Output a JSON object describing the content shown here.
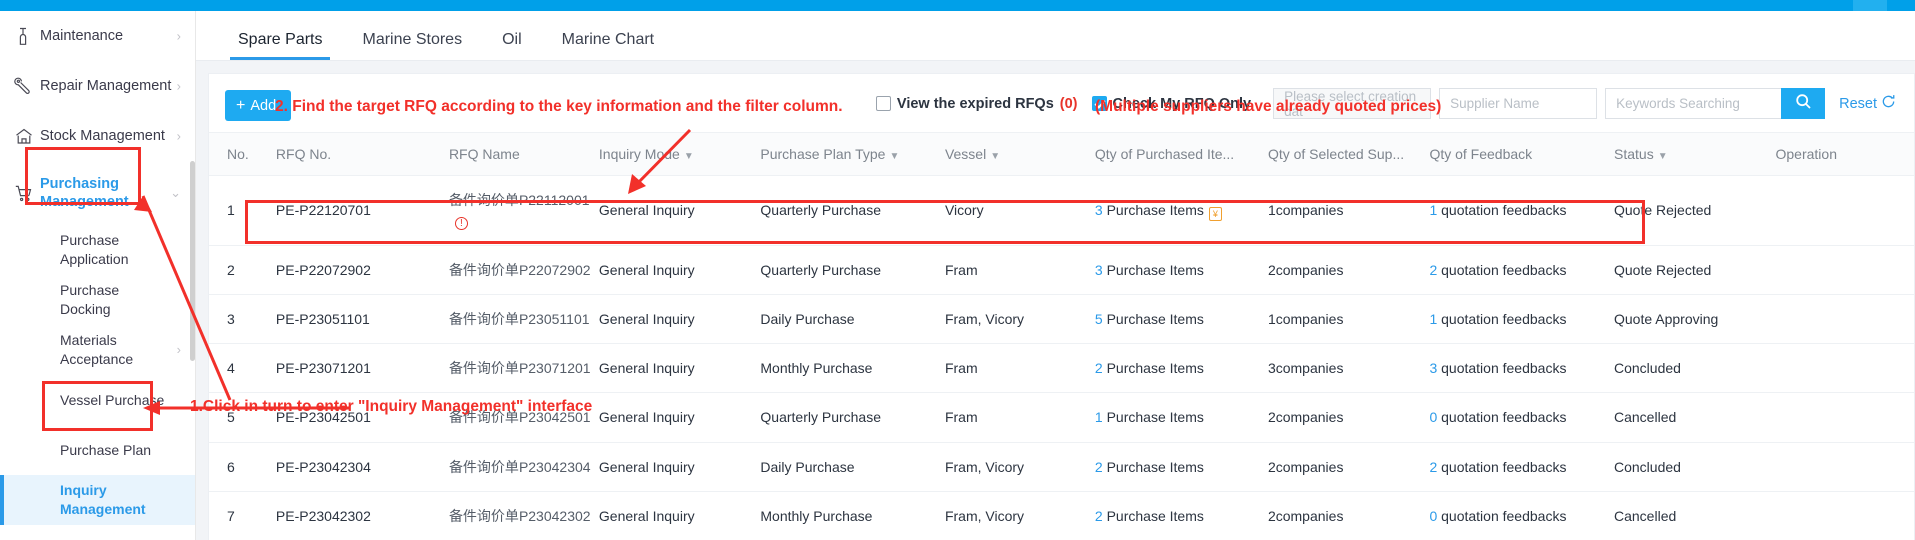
{
  "sidebar": {
    "items": [
      {
        "label": "Maintenance",
        "icon": "wrench-gauge-icon",
        "chevron": "›",
        "active": false,
        "expanded": false
      },
      {
        "label": "Repair Management",
        "icon": "wrench-icon",
        "chevron": "›",
        "active": false,
        "expanded": false
      },
      {
        "label": "Stock Management",
        "icon": "warehouse-icon",
        "chevron": "›",
        "active": false,
        "expanded": false
      },
      {
        "label": "Purchasing Management",
        "icon": "cart-icon",
        "chevron": "⌄",
        "active": true,
        "expanded": true
      }
    ],
    "sub_items": [
      {
        "label": "Purchase Application",
        "chevron": "",
        "selected": false
      },
      {
        "label": "Purchase Docking",
        "chevron": "",
        "selected": false
      },
      {
        "label": "Materials Acceptance",
        "chevron": "›",
        "selected": false
      },
      {
        "label": "Vessel Purchase",
        "chevron": "",
        "selected": false
      },
      {
        "label": "Purchase Plan",
        "chevron": "",
        "selected": false
      },
      {
        "label": "Inquiry Management",
        "chevron": "",
        "selected": true
      }
    ]
  },
  "tabs": [
    {
      "label": "Spare Parts",
      "active": true
    },
    {
      "label": "Marine Stores",
      "active": false
    },
    {
      "label": "Oil",
      "active": false
    },
    {
      "label": "Marine Chart",
      "active": false
    }
  ],
  "toolbar": {
    "add_label": "Add",
    "add_icon": "plus-icon",
    "expired_checkbox": {
      "label": "View the expired RFQs",
      "count": "(0)",
      "checked": false
    },
    "my_rfq_checkbox": {
      "label": "Check My RFQ Only",
      "checked": true
    },
    "date_field_placeholder": "Please select creation dat",
    "supplier_field_placeholder": "Supplier Name",
    "keywords_placeholder": "Keywords Searching",
    "search_icon": "search-icon",
    "reset_label": "Reset",
    "reset_icon": "refresh-icon"
  },
  "table": {
    "columns": [
      {
        "label": "No.",
        "sortable": false
      },
      {
        "label": "RFQ No.",
        "sortable": false
      },
      {
        "label": "RFQ Name",
        "sortable": false
      },
      {
        "label": "Inquiry Mode",
        "sortable": true
      },
      {
        "label": "Purchase Plan Type",
        "sortable": true
      },
      {
        "label": "Vessel",
        "sortable": true
      },
      {
        "label": "Qty of Purchased Ite...",
        "sortable": false
      },
      {
        "label": "Qty of Selected Sup...",
        "sortable": false
      },
      {
        "label": "Qty of Feedback",
        "sortable": false
      },
      {
        "label": "Status",
        "sortable": true
      },
      {
        "label": "Operation",
        "sortable": false
      }
    ],
    "rows": [
      {
        "no": "1",
        "rfq_no": "PE-P22120701",
        "rfq_name_prefix": "备件询价单",
        "rfq_name_code": "P22112001",
        "has_warn_icon": true,
        "has_badge_icon": true,
        "inquiry_mode": "General Inquiry",
        "plan_type": "Quarterly Purchase",
        "vessel": "Vicory",
        "qty_items_num": "3",
        "qty_items_text": "Purchase Items",
        "qty_sup_num": "1",
        "qty_sup_text": "companies",
        "qty_fb_num": "1",
        "qty_fb_text": "quotation feedbacks",
        "status": "Quote Rejected",
        "operation": "",
        "highlighted": false
      },
      {
        "no": "2",
        "rfq_no": "PE-P22072902",
        "rfq_name_prefix": "备件询价单",
        "rfq_name_code": "P22072902",
        "has_warn_icon": false,
        "has_badge_icon": false,
        "inquiry_mode": "General Inquiry",
        "plan_type": "Quarterly Purchase",
        "vessel": "Fram",
        "qty_items_num": "3",
        "qty_items_text": "Purchase Items",
        "qty_sup_num": "2",
        "qty_sup_text": "companies",
        "qty_fb_num": "2",
        "qty_fb_text": "quotation feedbacks",
        "status": "Quote Rejected",
        "operation": "",
        "highlighted": true
      },
      {
        "no": "3",
        "rfq_no": "PE-P23051101",
        "rfq_name_prefix": "备件询价单",
        "rfq_name_code": "P23051101",
        "has_warn_icon": false,
        "has_badge_icon": false,
        "inquiry_mode": "General Inquiry",
        "plan_type": "Daily Purchase",
        "vessel": "Fram, Vicory",
        "qty_items_num": "5",
        "qty_items_text": "Purchase Items",
        "qty_sup_num": "1",
        "qty_sup_text": "companies",
        "qty_fb_num": "1",
        "qty_fb_text": "quotation feedbacks",
        "status": "Quote Approving",
        "operation": "",
        "highlighted": false
      },
      {
        "no": "4",
        "rfq_no": "PE-P23071201",
        "rfq_name_prefix": "备件询价单",
        "rfq_name_code": "P23071201",
        "has_warn_icon": false,
        "has_badge_icon": false,
        "inquiry_mode": "General Inquiry",
        "plan_type": "Monthly Purchase",
        "vessel": "Fram",
        "qty_items_num": "2",
        "qty_items_text": "Purchase Items",
        "qty_sup_num": "3",
        "qty_sup_text": "companies",
        "qty_fb_num": "3",
        "qty_fb_text": "quotation feedbacks",
        "status": "Concluded",
        "operation": "",
        "highlighted": false
      },
      {
        "no": "5",
        "rfq_no": "PE-P23042501",
        "rfq_name_prefix": "备件询价单",
        "rfq_name_code": "P23042501",
        "has_warn_icon": false,
        "has_badge_icon": false,
        "inquiry_mode": "General Inquiry",
        "plan_type": "Quarterly Purchase",
        "vessel": "Fram",
        "qty_items_num": "1",
        "qty_items_text": "Purchase Items",
        "qty_sup_num": "2",
        "qty_sup_text": "companies",
        "qty_fb_num": "0",
        "qty_fb_text": "quotation feedbacks",
        "status": "Cancelled",
        "operation": "",
        "highlighted": false
      },
      {
        "no": "6",
        "rfq_no": "PE-P23042304",
        "rfq_name_prefix": "备件询价单",
        "rfq_name_code": "P23042304",
        "has_warn_icon": false,
        "has_badge_icon": false,
        "inquiry_mode": "General Inquiry",
        "plan_type": "Daily Purchase",
        "vessel": "Fram, Vicory",
        "qty_items_num": "2",
        "qty_items_text": "Purchase Items",
        "qty_sup_num": "2",
        "qty_sup_text": "companies",
        "qty_fb_num": "2",
        "qty_fb_text": "quotation feedbacks",
        "status": "Concluded",
        "operation": "",
        "highlighted": false
      },
      {
        "no": "7",
        "rfq_no": "PE-P23042302",
        "rfq_name_prefix": "备件询价单",
        "rfq_name_code": "P23042302",
        "has_warn_icon": false,
        "has_badge_icon": false,
        "inquiry_mode": "General Inquiry",
        "plan_type": "Monthly Purchase",
        "vessel": "Fram, Vicory",
        "qty_items_num": "2",
        "qty_items_text": "Purchase Items",
        "qty_sup_num": "2",
        "qty_sup_text": "companies",
        "qty_fb_num": "0",
        "qty_fb_text": "quotation feedbacks",
        "status": "Cancelled",
        "operation": "",
        "highlighted": false
      }
    ]
  },
  "annotations": {
    "step1": "1.Click in turn to enter \"Inquiry Management\" interface",
    "step2": "2. Find the target RFQ according to the key information and the filter column.",
    "step2_note": "(Multiple suppliers have already quoted prices)",
    "color": "#f2302a"
  }
}
